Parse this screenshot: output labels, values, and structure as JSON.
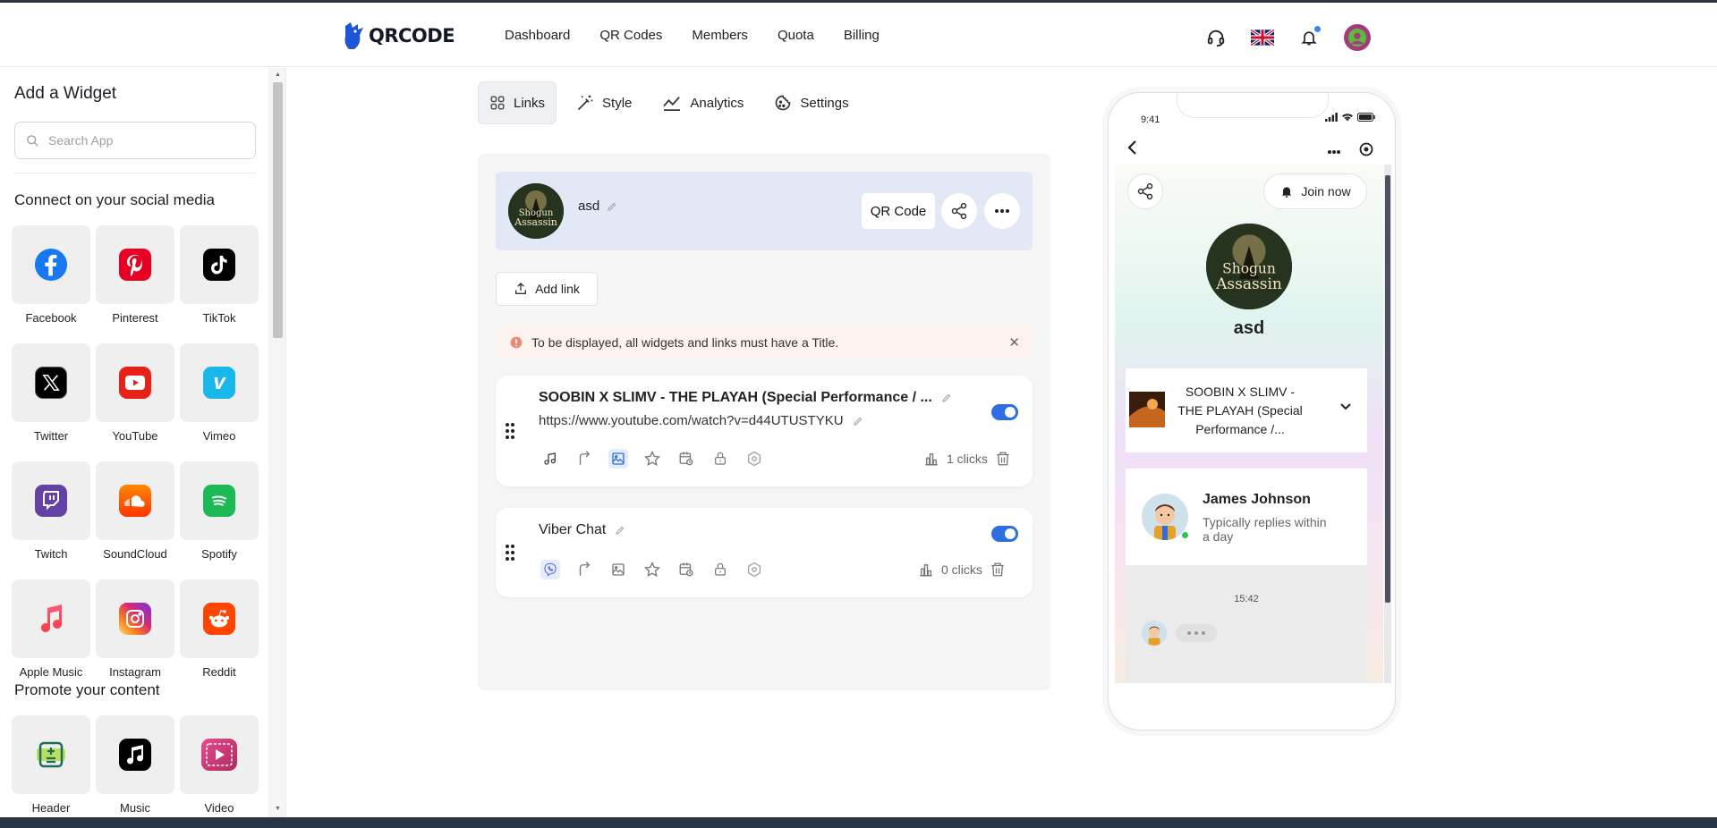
{
  "header": {
    "logo_text": "QRCODE",
    "nav": [
      "Dashboard",
      "QR Codes",
      "Members",
      "Quota",
      "Billing"
    ]
  },
  "sidebar": {
    "title": "Add a Widget",
    "search_placeholder": "Search App",
    "section_social": "Connect on your social media",
    "social": [
      {
        "label": "Facebook",
        "icon": "facebook-icon",
        "color": "#1877f2"
      },
      {
        "label": "Pinterest",
        "icon": "pinterest-icon",
        "color": "#e60023"
      },
      {
        "label": "TikTok",
        "icon": "tiktok-icon",
        "color": "#000000"
      },
      {
        "label": "Twitter",
        "icon": "x-icon",
        "color": "#000000"
      },
      {
        "label": "YouTube",
        "icon": "youtube-icon",
        "color": "#e62117"
      },
      {
        "label": "Vimeo",
        "icon": "vimeo-icon",
        "color": "#1ab7ea"
      },
      {
        "label": "Twitch",
        "icon": "twitch-icon",
        "color": "#6441a5"
      },
      {
        "label": "SoundCloud",
        "icon": "soundcloud-icon",
        "color": "#ff5500"
      },
      {
        "label": "Spotify",
        "icon": "spotify-icon",
        "color": "#1db954"
      },
      {
        "label": "Apple Music",
        "icon": "apple-music-icon",
        "color": "#fa3a5b"
      },
      {
        "label": "Instagram",
        "icon": "instagram-icon",
        "color": "#d62976"
      },
      {
        "label": "Reddit",
        "icon": "reddit-icon",
        "color": "#ff4500"
      }
    ],
    "section_promote": "Promote your content",
    "promote": [
      {
        "label": "Header",
        "icon": "header-icon"
      },
      {
        "label": "Music",
        "icon": "music-icon"
      },
      {
        "label": "Video",
        "icon": "video-icon"
      }
    ]
  },
  "tabs": [
    {
      "label": "Links",
      "icon": "grid-icon",
      "active": true
    },
    {
      "label": "Style",
      "icon": "magic-wand-icon",
      "active": false
    },
    {
      "label": "Analytics",
      "icon": "chart-line-icon",
      "active": false
    },
    {
      "label": "Settings",
      "icon": "cookie-gear-icon",
      "active": false
    }
  ],
  "profile": {
    "name": "asd",
    "qr_button": "QR Code"
  },
  "add_link_label": "Add link",
  "alert_text": "To be displayed, all widgets and links must have a Title.",
  "links": [
    {
      "title": "SOOBIN X SLIMV - THE PLAYAH (Special Performance / ...",
      "url": "https://www.youtube.com/watch?v=d44UTUSTYKU",
      "clicks": "1 clicks",
      "enabled": true
    },
    {
      "title": "Viber Chat",
      "clicks": "0 clicks",
      "enabled": true
    }
  ],
  "phone": {
    "time": "9:41",
    "join_label": "Join now",
    "name": "asd",
    "music_title": "SOOBIN X SLIMV - THE PLAYAH (Special Performance /...",
    "agent_name": "James Johnson",
    "agent_sub": "Typically replies within a day",
    "chat_time": "15:42"
  },
  "colors": {
    "accent": "#2f6ee0",
    "profile_bg": "#e3e8f6",
    "alert_bg": "#fcf3ef"
  }
}
